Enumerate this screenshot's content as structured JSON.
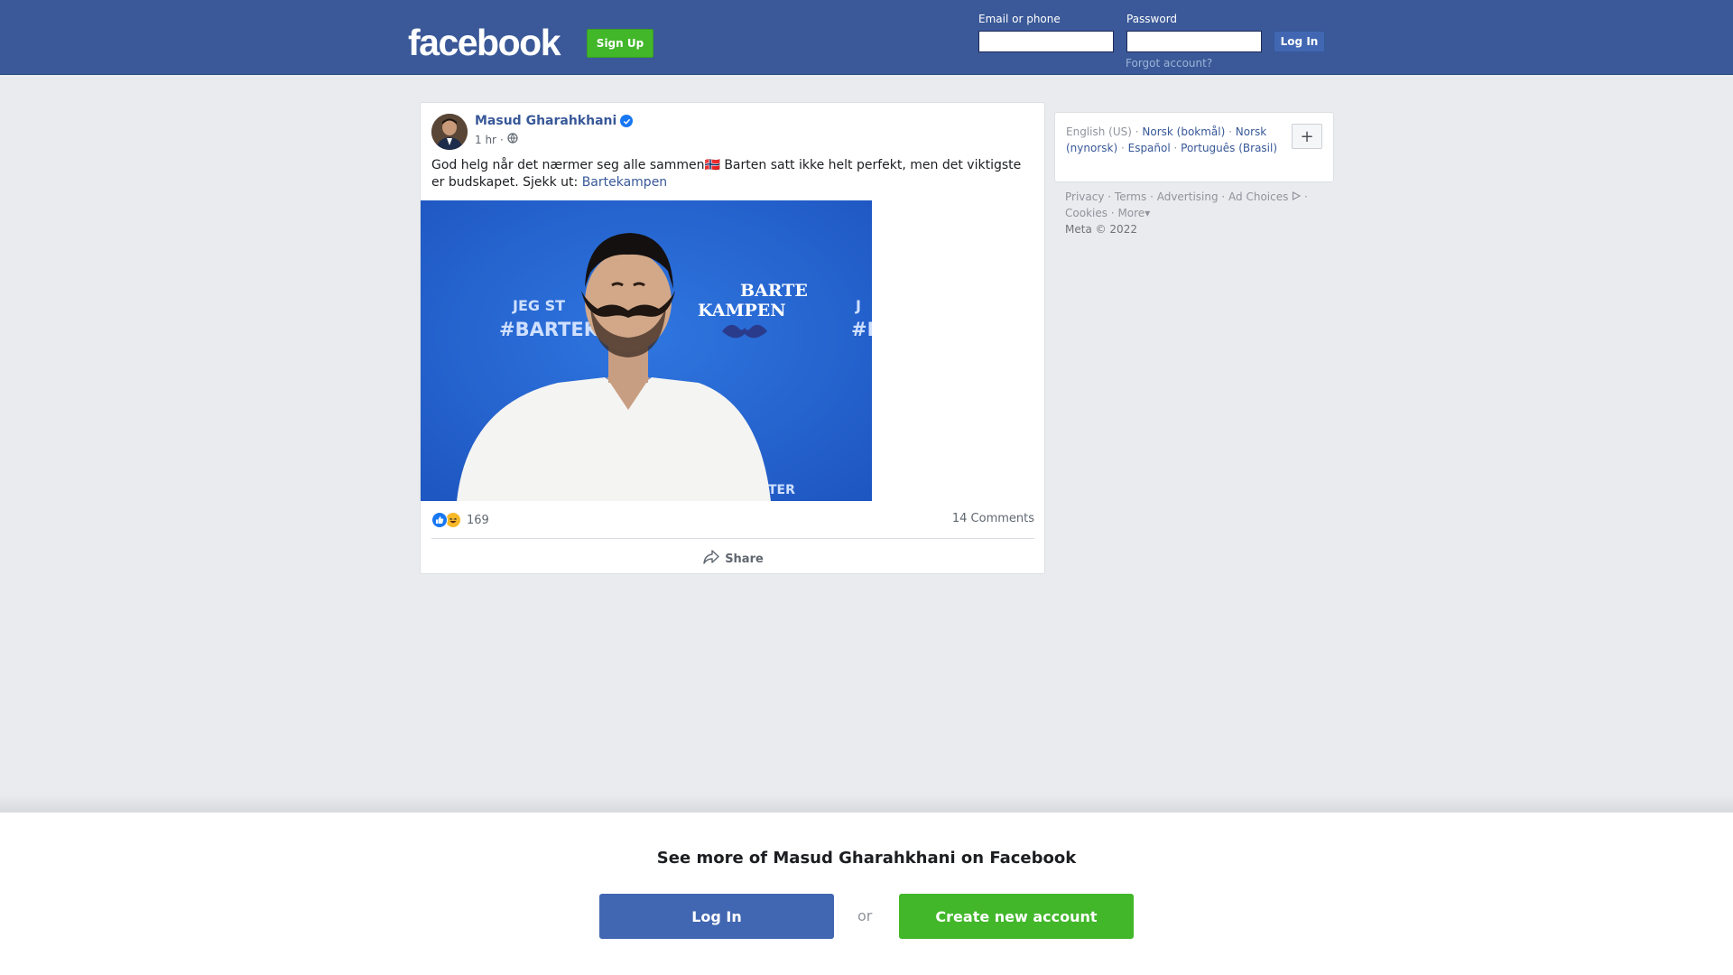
{
  "header": {
    "logo": "facebook",
    "signup_label": "Sign Up",
    "email_label": "Email or phone",
    "password_label": "Password",
    "login_label": "Log In",
    "forgot_label": "Forgot account?"
  },
  "post": {
    "author": "Masud Gharahkhani",
    "time": "1 hr",
    "text": "God helg når det nærmer seg alle sammen🇳🇴 Barten satt ikke helt perfekt, men det viktigste er budskapet. Sjekk ut: ",
    "link_text": "Bartekampen",
    "photo": {
      "text_line1": "JEG ST",
      "text_line2": "#BARTEK",
      "brand_line1": "BARTE",
      "brand_line2": "KAMPEN",
      "right_line1": "J",
      "right_line2": "#B",
      "bottom_text": "TER"
    },
    "reaction_count": "169",
    "comments": "14 Comments",
    "share_label": "Share"
  },
  "languages": {
    "current": "English (US)",
    "others": [
      "Norsk (bokmål)",
      "Norsk (nynorsk)",
      "Español",
      "Português (Brasil)"
    ],
    "add_label": "+"
  },
  "footer": {
    "links": [
      "Privacy",
      "Terms",
      "Advertising",
      "Ad Choices",
      "Cookies",
      "More"
    ],
    "copyright": "Meta © 2022"
  },
  "bottom_prompt": {
    "title": "See more of Masud Gharahkhani on Facebook",
    "login_label": "Log In",
    "or_label": "or",
    "create_label": "Create new account"
  },
  "colors": {
    "brand_blue": "#3b5998",
    "link_blue": "#385898",
    "green": "#42b72a",
    "button_blue": "#4267b2"
  }
}
